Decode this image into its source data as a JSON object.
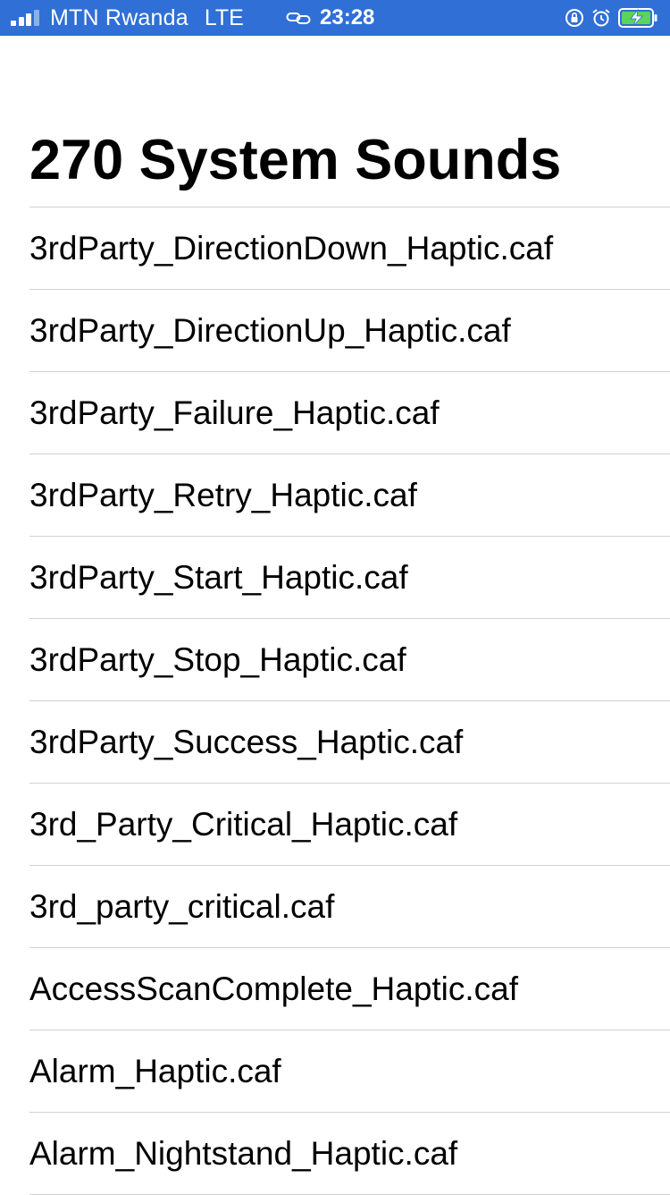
{
  "status_bar": {
    "carrier": "MTN Rwanda",
    "network": "LTE",
    "time": "23:28",
    "signal_bars_filled": 3,
    "signal_bars_total": 4,
    "background_color": "#2f6fd6",
    "icons": [
      "signal-icon",
      "link-icon",
      "orientation-lock-icon",
      "alarm-icon",
      "battery-charging-icon"
    ]
  },
  "page": {
    "title": "270 System Sounds"
  },
  "sounds": [
    "3rdParty_DirectionDown_Haptic.caf",
    "3rdParty_DirectionUp_Haptic.caf",
    "3rdParty_Failure_Haptic.caf",
    "3rdParty_Retry_Haptic.caf",
    "3rdParty_Start_Haptic.caf",
    "3rdParty_Stop_Haptic.caf",
    "3rdParty_Success_Haptic.caf",
    "3rd_Party_Critical_Haptic.caf",
    "3rd_party_critical.caf",
    "AccessScanComplete_Haptic.caf",
    "Alarm_Haptic.caf",
    "Alarm_Nightstand_Haptic.caf"
  ]
}
